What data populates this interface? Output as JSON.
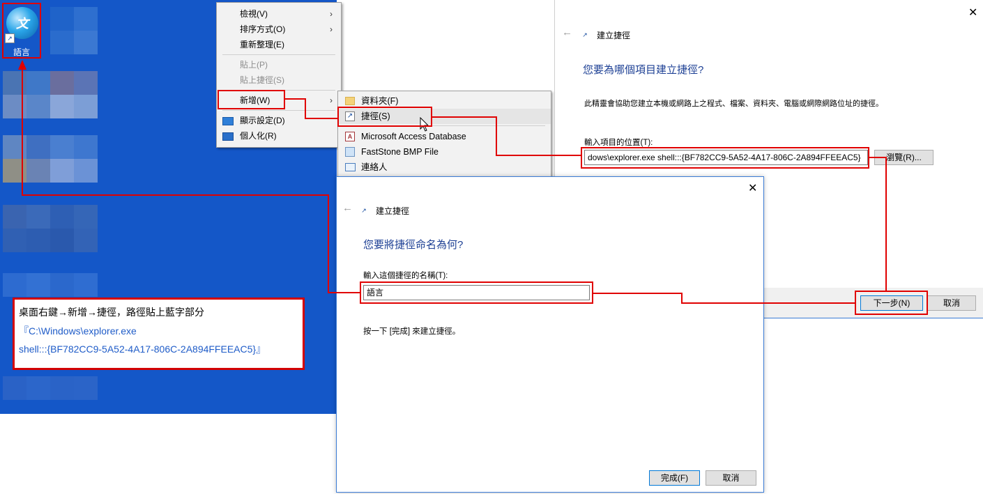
{
  "desktop": {
    "icon_label": "語言"
  },
  "context_menu": {
    "items": [
      {
        "label": "檢視(V)",
        "has_submenu": true,
        "disabled": false
      },
      {
        "label": "排序方式(O)",
        "has_submenu": true,
        "disabled": false
      },
      {
        "label": "重新整理(E)",
        "has_submenu": false,
        "disabled": false
      },
      {
        "label": "貼上(P)",
        "has_submenu": false,
        "disabled": true
      },
      {
        "label": "貼上捷徑(S)",
        "has_submenu": false,
        "disabled": true
      },
      {
        "label": "新增(W)",
        "has_submenu": true,
        "disabled": false
      },
      {
        "label": "顯示設定(D)",
        "has_submenu": false,
        "disabled": false,
        "icon": "display-settings-icon"
      },
      {
        "label": "個人化(R)",
        "has_submenu": false,
        "disabled": false,
        "icon": "personalize-icon"
      }
    ]
  },
  "new_submenu": {
    "items": [
      {
        "label": "資料夾(F)",
        "icon": "folder-icon"
      },
      {
        "label": "捷徑(S)",
        "icon": "shortcut-icon",
        "highlighted": true
      },
      {
        "label": "Microsoft Access Database",
        "icon": "access-database-icon"
      },
      {
        "label": "FastStone BMP File",
        "icon": "bmp-file-icon"
      },
      {
        "label": "連絡人",
        "icon": "contact-icon"
      }
    ]
  },
  "wizard_location": {
    "title": "建立捷徑",
    "heading": "您要為哪個項目建立捷徑?",
    "description": "此精靈會協助您建立本機或網路上之程式、檔案、資料夾、電腦或網際網路位址的捷徑。",
    "location_label": "輸入項目的位置(T):",
    "location_value": "dows\\explorer.exe shell:::{BF782CC9-5A52-4A17-806C-2A894FFEEAC5}",
    "browse_label": "瀏覽(R)...",
    "next_label": "下一步(N)",
    "cancel_label": "取消"
  },
  "wizard_name": {
    "title": "建立捷徑",
    "heading": "您要將捷徑命名為何?",
    "name_label": "輸入這個捷徑的名稱(T):",
    "name_value": "語言",
    "hint": "按一下 [完成] 來建立捷徑。",
    "finish_label": "完成(F)",
    "cancel_label": "取消"
  },
  "annotation": {
    "line1": "桌面右鍵→新增→捷徑，路徑貼上藍字部分",
    "line2": "『C:\\Windows\\explorer.exe",
    "line3": "shell:::{BF782CC9-5A52-4A17-806C-2A894FFEEAC5}』"
  },
  "colors": {
    "desktop_blue": "#1457c8",
    "annotation_red": "#e00000",
    "heading_blue": "#1c3f94",
    "annotation_text_blue": "#1f5cc8"
  }
}
